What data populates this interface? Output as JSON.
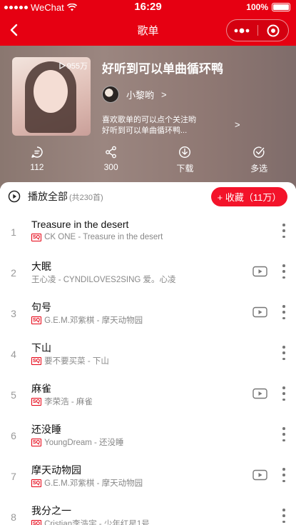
{
  "status_bar": {
    "carrier": "WeChat",
    "time": "16:29",
    "battery": "100%"
  },
  "nav": {
    "title": "歌单"
  },
  "playlist": {
    "play_count": "955万",
    "title": "好听到可以单曲循环鸭",
    "creator": "小黎哟",
    "creator_arrow": ">",
    "description_line1": "喜欢歌单的可以点个关注哟",
    "description_line2": "好听到可以单曲循环鸭...",
    "description_arrow": ">"
  },
  "actions": [
    {
      "icon": "comment-icon",
      "label": "112"
    },
    {
      "icon": "share-icon",
      "label": "300"
    },
    {
      "icon": "download-icon",
      "label": "下载"
    },
    {
      "icon": "multi-select-icon",
      "label": "多选"
    }
  ],
  "list_header": {
    "play_all": "播放全部",
    "count": "(共230首)",
    "collect": "+ 收藏（11万）"
  },
  "songs": [
    {
      "index": "1",
      "title": "Treasure in the desert",
      "subtitle": "CK ONE - Treasure in the desert",
      "sq": true,
      "mv": false
    },
    {
      "index": "2",
      "title": "大眠",
      "subtitle": "王心凌 - CYNDILOVES2SING 爱。心凌",
      "sq": false,
      "mv": true
    },
    {
      "index": "3",
      "title": "句号",
      "subtitle": "G.E.M.邓紫棋 - 摩天动物园",
      "sq": true,
      "mv": true
    },
    {
      "index": "4",
      "title": "下山",
      "subtitle": "要不要买菜 - 下山",
      "sq": true,
      "mv": false
    },
    {
      "index": "5",
      "title": "麻雀",
      "subtitle": "李荣浩 - 麻雀",
      "sq": true,
      "mv": true
    },
    {
      "index": "6",
      "title": "还没睡",
      "subtitle": "YoungDream - 还没睡",
      "sq": true,
      "mv": false
    },
    {
      "index": "7",
      "title": "摩天动物园",
      "subtitle": "G.E.M.邓紫棋 - 摩天动物园",
      "sq": true,
      "mv": true
    },
    {
      "index": "8",
      "title": "我分之一",
      "subtitle": "Cristian李浩宇 - 少年红星1号",
      "sq": true,
      "mv": false
    }
  ],
  "sq_badge": "SQ",
  "colors": {
    "brand_red": "#e60012",
    "collect_red": "#f3132a"
  }
}
